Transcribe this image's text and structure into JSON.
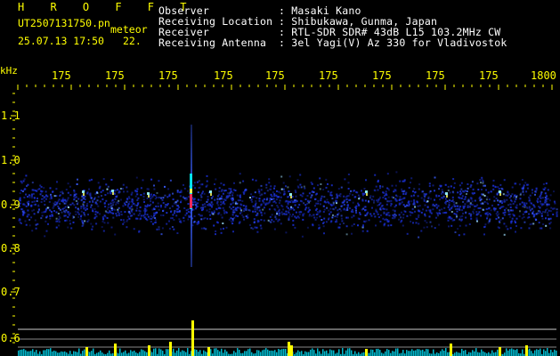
{
  "header": {
    "title": "H R O F F T",
    "filename": "UT2507131750.pn",
    "type": "meteor",
    "timestamp": "25.07.13 17:50",
    "count": "22."
  },
  "info": {
    "observer_label": "Observer",
    "observer_value": ": Masaki Kano",
    "location_label": "Receiving Location",
    "location_value": ": Shibukawa, Gunma, Japan",
    "receiver_label": "Receiver",
    "receiver_value": ": RTL-SDR SDR# 43dB L15 103.2MHz CW",
    "antenna_label": "Receiving Antenna",
    "antenna_value": ": 3el Yagi(V) Az 330 for Vladivostok"
  },
  "time_axis": {
    "ticks": [
      "175",
      "175",
      "175",
      "175",
      "175",
      "175",
      "175",
      "175",
      "175",
      "1800"
    ]
  },
  "freq_axis": {
    "unit": "kHz",
    "ticks": [
      "1.1",
      "1.0",
      "0.9",
      "0.8",
      "0.7",
      "0.6"
    ]
  },
  "colors": {
    "text_yellow": "#ffff00",
    "text_cyan": "#00e5ff",
    "noise_blue": "#1a2fd0",
    "meteor_red": "#ff2050",
    "histogram_yellow": "#ffff00",
    "histogram_cyan": "#00e5ff"
  }
}
